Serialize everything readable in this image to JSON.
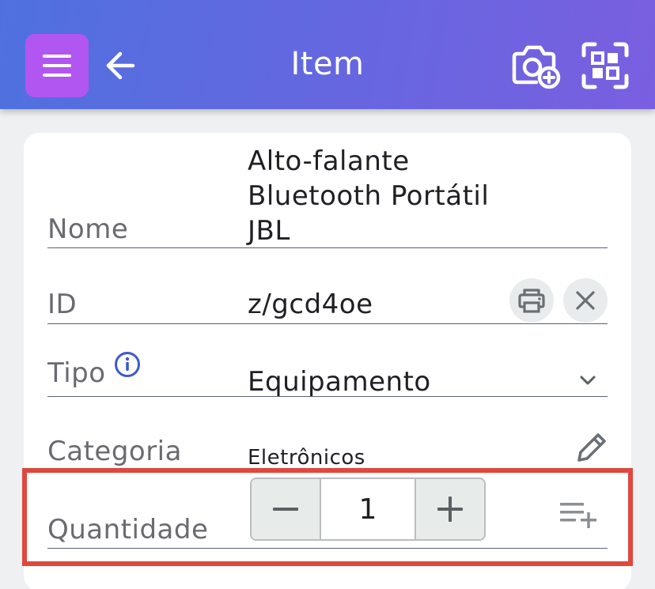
{
  "header": {
    "title": "Item",
    "menu_icon": "hamburger-menu-icon",
    "back_icon": "arrow-left-icon",
    "camera_icon": "camera-add-icon",
    "scan_icon": "qr-scan-icon",
    "gradient_start": "#4f71df",
    "gradient_end": "#7a5fe0",
    "menu_color": "#b256f2"
  },
  "form": {
    "name": {
      "label": "Nome",
      "value_lines": [
        "Alto-falante",
        "Bluetooth Portátil",
        "JBL"
      ]
    },
    "id": {
      "label": "ID",
      "value": "z/gcd4oe",
      "print_icon": "printer-icon",
      "clear_icon": "close-icon"
    },
    "type": {
      "label": "Tipo",
      "value": "Equipamento",
      "info_icon": "info-icon",
      "dropdown_icon": "chevron-down-icon"
    },
    "category": {
      "label": "Categoria",
      "value": "Eletrônicos",
      "edit_icon": "pencil-icon"
    },
    "quantity": {
      "label": "Quantidade",
      "value": "1",
      "decrement_icon": "minus-icon",
      "increment_icon": "plus-icon",
      "add_list_icon": "playlist-add-icon"
    }
  },
  "highlight_color": "#e0473f"
}
